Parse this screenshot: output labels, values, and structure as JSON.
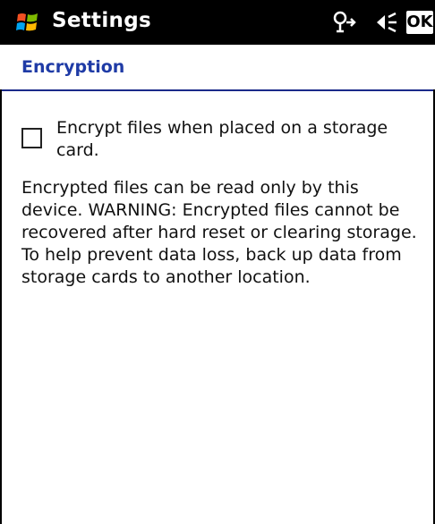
{
  "titlebar": {
    "title": "Settings",
    "ok_label": "OK",
    "icons": {
      "start": "windows-flag-icon",
      "connectivity": "connectivity-icon",
      "volume": "speaker-icon"
    },
    "background": "#000000"
  },
  "page": {
    "title": "Encryption",
    "title_color": "#1f3ba6",
    "checkbox": {
      "label": "Encrypt files when placed on a storage card.",
      "checked": false
    },
    "description": "Encrypted files can be read only by this device. WARNING: Encrypted files cannot be recovered after hard reset or clearing storage. To help prevent data loss, back up data from storage cards to another location."
  }
}
